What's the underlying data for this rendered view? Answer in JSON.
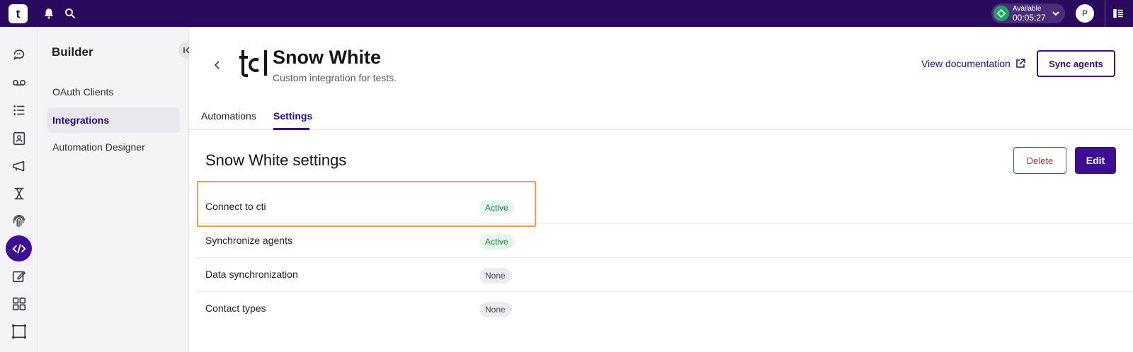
{
  "app": {
    "logo_text": "t",
    "status": {
      "label": "Available",
      "time": "00:05:27",
      "color": "#1fa363"
    },
    "user_initial": "P",
    "accent": "#3d0e8f",
    "topbar_color": "#2a0a5e"
  },
  "rail": {
    "items": [
      {
        "icon": "chat-icon"
      },
      {
        "icon": "voicemail-icon"
      },
      {
        "icon": "list-numbered-icon"
      },
      {
        "icon": "contacts-book-icon"
      },
      {
        "icon": "megaphone-icon"
      },
      {
        "icon": "flow-icon"
      },
      {
        "icon": "fingerprint-icon"
      },
      {
        "icon": "code-icon",
        "active": true
      },
      {
        "icon": "edit-icon"
      },
      {
        "icon": "grid-icon"
      },
      {
        "icon": "frame-icon"
      }
    ]
  },
  "sidebar": {
    "title": "Builder",
    "items": [
      {
        "label": "OAuth Clients"
      },
      {
        "label": "Integrations",
        "active": true
      },
      {
        "label": "Automation Designer"
      }
    ]
  },
  "header": {
    "title": "Snow White",
    "subtitle": "Custom integration for tests.",
    "doc_link": "View documentation",
    "sync_button": "Sync agents"
  },
  "tabs": [
    {
      "label": "Automations"
    },
    {
      "label": "Settings",
      "active": true
    }
  ],
  "settings": {
    "title": "Snow White settings",
    "delete_label": "Delete",
    "edit_label": "Edit",
    "rows": [
      {
        "label": "Connect to cti",
        "status": "Active"
      },
      {
        "label": "Synchronize agents",
        "status": "Active"
      },
      {
        "label": "Data synchronization",
        "status": "None"
      },
      {
        "label": "Contact types",
        "status": "None"
      }
    ]
  }
}
